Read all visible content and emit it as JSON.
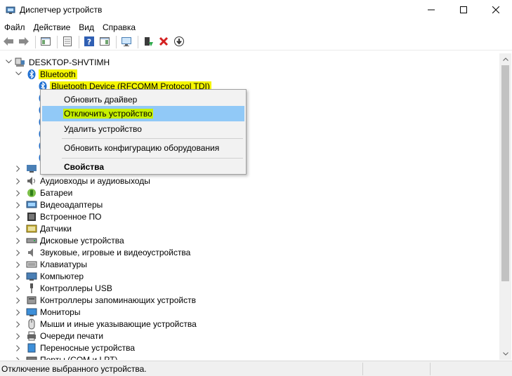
{
  "window": {
    "title": "Диспетчер устройств"
  },
  "menubar": {
    "items": [
      "Файл",
      "Действие",
      "Вид",
      "Справка"
    ]
  },
  "tree": {
    "computer": "DESKTOP-SHVTIMH",
    "bluetooth": {
      "label": "Bluetooth",
      "highlight_color": "#f4f500",
      "device": "Bluetooth Device (RFCOMM Protocol TDI)"
    },
    "categories": [
      "Аудиовходы и аудиовыходы",
      "Батареи",
      "Видеоадаптеры",
      "Встроенное ПО",
      "Датчики",
      "Дисковые устройства",
      "Звуковые, игровые и видеоустройства",
      "Клавиатуры",
      "Компьютер",
      "Контроллеры USB",
      "Контроллеры запоминающих устройств",
      "Мониторы",
      "Мыши и иные указывающие устройства",
      "Очереди печати",
      "Переносные устройства",
      "Порты (COM и LPT)"
    ]
  },
  "context_menu": {
    "update_driver": "Обновить драйвер",
    "disable_device": "Отключить устройство",
    "uninstall_device": "Удалить устройство",
    "scan_hardware": "Обновить конфигурацию оборудования",
    "properties": "Свойства",
    "active_color": "#91c9f7",
    "highlight_color": "#c6f000"
  },
  "statusbar": {
    "text": "Отключение выбранного устройства."
  }
}
